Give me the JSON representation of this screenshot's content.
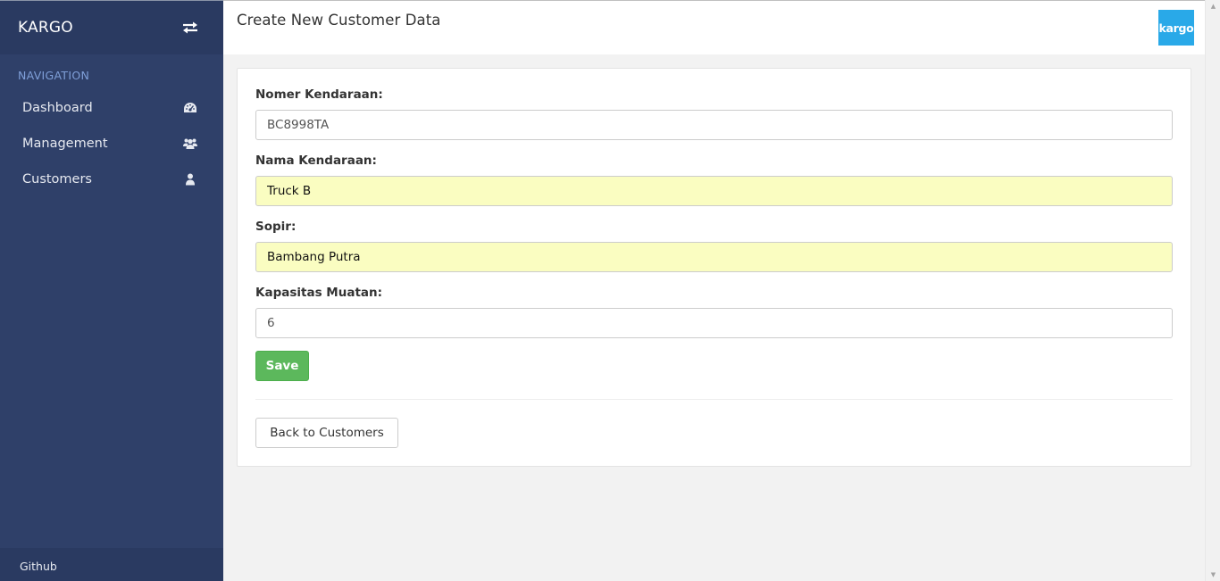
{
  "sidebar": {
    "brand": "KARGO",
    "nav_heading": "NAVIGATION",
    "items": [
      {
        "label": "Dashboard",
        "icon": "dashboard-gauge-icon"
      },
      {
        "label": "Management",
        "icon": "users-group-icon"
      },
      {
        "label": "Customers",
        "icon": "user-icon"
      }
    ],
    "footer_link": "Github",
    "toggle_icon": "exchange-arrows-icon"
  },
  "header": {
    "title": "Create New Customer Data",
    "logo_text": "kargo"
  },
  "form": {
    "fields": [
      {
        "label": "Nomer Kendaraan:",
        "value": "BC8998TA"
      },
      {
        "label": "Nama Kendaraan:",
        "value": "Truck B"
      },
      {
        "label": "Sopir:",
        "value": "Bambang Putra"
      },
      {
        "label": "Kapasitas Muatan:",
        "value": "6"
      }
    ],
    "save_label": "Save",
    "back_label": "Back to Customers"
  },
  "colors": {
    "sidebar_bg": "#2f4069",
    "sidebar_header_bg": "#2a3a61",
    "nav_heading": "#7f9fd8",
    "logo_bg": "#29a9e8",
    "save_button": "#5cb85c",
    "autofill_bg": "#fafdc1",
    "page_bg": "#f2f2f2"
  }
}
